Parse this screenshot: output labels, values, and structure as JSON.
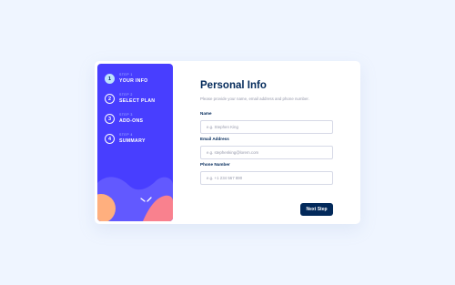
{
  "sidebar": {
    "steps": [
      {
        "number": "1",
        "label": "STEP 1",
        "title": "YOUR INFO"
      },
      {
        "number": "2",
        "label": "STEP 2",
        "title": "SELECT PLAN"
      },
      {
        "number": "3",
        "label": "STEP 3",
        "title": "ADD-ONS"
      },
      {
        "number": "4",
        "label": "STEP 4",
        "title": "SUMMARY"
      }
    ],
    "active_step": "1"
  },
  "form": {
    "title": "Personal Info",
    "subtitle": "Please provide your name, email address and phone number.",
    "fields": [
      {
        "label": "Name",
        "placeholder": "e.g. Stephen King",
        "value": ""
      },
      {
        "label": "Email Address",
        "placeholder": "e.g. stephenking@lorem.com",
        "value": ""
      },
      {
        "label": "Phone Number",
        "placeholder": "e.g. +1 234 567 890",
        "value": ""
      }
    ],
    "next_label": "Next Step"
  },
  "colors": {
    "background": "#eff5ff",
    "sidebar": "#483eff",
    "active_step": "#bee2fd",
    "primary": "#02295a",
    "muted": "#9699ab",
    "border": "#d6d9e6"
  }
}
